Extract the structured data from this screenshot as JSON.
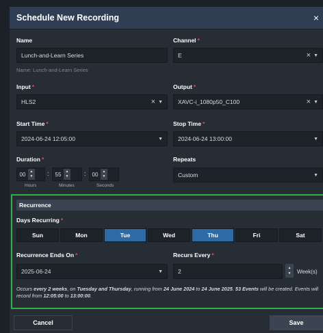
{
  "dialog": {
    "title": "Schedule New Recording",
    "close_glyph": "×"
  },
  "name": {
    "label": "Name",
    "value": "Lunch-and-Learn Series",
    "hint": "Name: Lunch-and-Learn Series"
  },
  "channel": {
    "label": "Channel",
    "value": "E",
    "required": "*"
  },
  "input": {
    "label": "Input",
    "value": "HLS2",
    "required": "*"
  },
  "output": {
    "label": "Output",
    "value": "XAVC-i_1080p50_C100",
    "required": "*"
  },
  "start_time": {
    "label": "Start Time",
    "value": "2024-06-24 12:05:00",
    "required": "*"
  },
  "stop_time": {
    "label": "Stop Time",
    "value": "2024-06-24 13:00:00",
    "required": "*"
  },
  "duration": {
    "label": "Duration",
    "required": "*",
    "hours": "00",
    "minutes": "55",
    "seconds": "00",
    "hours_caption": "Hours",
    "minutes_caption": "Minutes",
    "seconds_caption": "Seconds",
    "colon": ":"
  },
  "repeats": {
    "label": "Repeats",
    "value": "Custom"
  },
  "recurrence": {
    "section_title": "Recurrence",
    "days_label": "Days Recurring",
    "required": "*",
    "days": [
      {
        "label": "Sun",
        "selected": false
      },
      {
        "label": "Mon",
        "selected": false
      },
      {
        "label": "Tue",
        "selected": true
      },
      {
        "label": "Wed",
        "selected": false
      },
      {
        "label": "Thu",
        "selected": true
      },
      {
        "label": "Fri",
        "selected": false
      },
      {
        "label": "Sat",
        "selected": false
      }
    ],
    "ends_on_label": "Recurrence Ends On",
    "ends_on_value": "2025-06-24",
    "every_label": "Recurs Every",
    "every_value": "2",
    "every_unit": "Week(s)",
    "summary": {
      "p1": "Occurs ",
      "b1": "every 2 weeks",
      "p2": ", on ",
      "b2": "Tuesday and Thursday",
      "p3": ", running from ",
      "b3": "24 June 2024",
      "p4": " to ",
      "b4": "24 June 2025",
      "p5": ". ",
      "b5": "53 Events",
      "p6": " will be created. Events will record from ",
      "b6": "12:05:00",
      "p7": " to ",
      "b7": "13:00:00",
      "p8": "."
    }
  },
  "footer": {
    "cancel_label": "Cancel",
    "save_label": "Save"
  },
  "icons": {
    "clear": "×",
    "dropdown": "▼",
    "up": "▲",
    "down": "▼"
  },
  "colors": {
    "accent_selected": "#2e6aa6",
    "highlight_border": "#34b04a",
    "required": "#e0505a",
    "header": "#2f3e52"
  }
}
